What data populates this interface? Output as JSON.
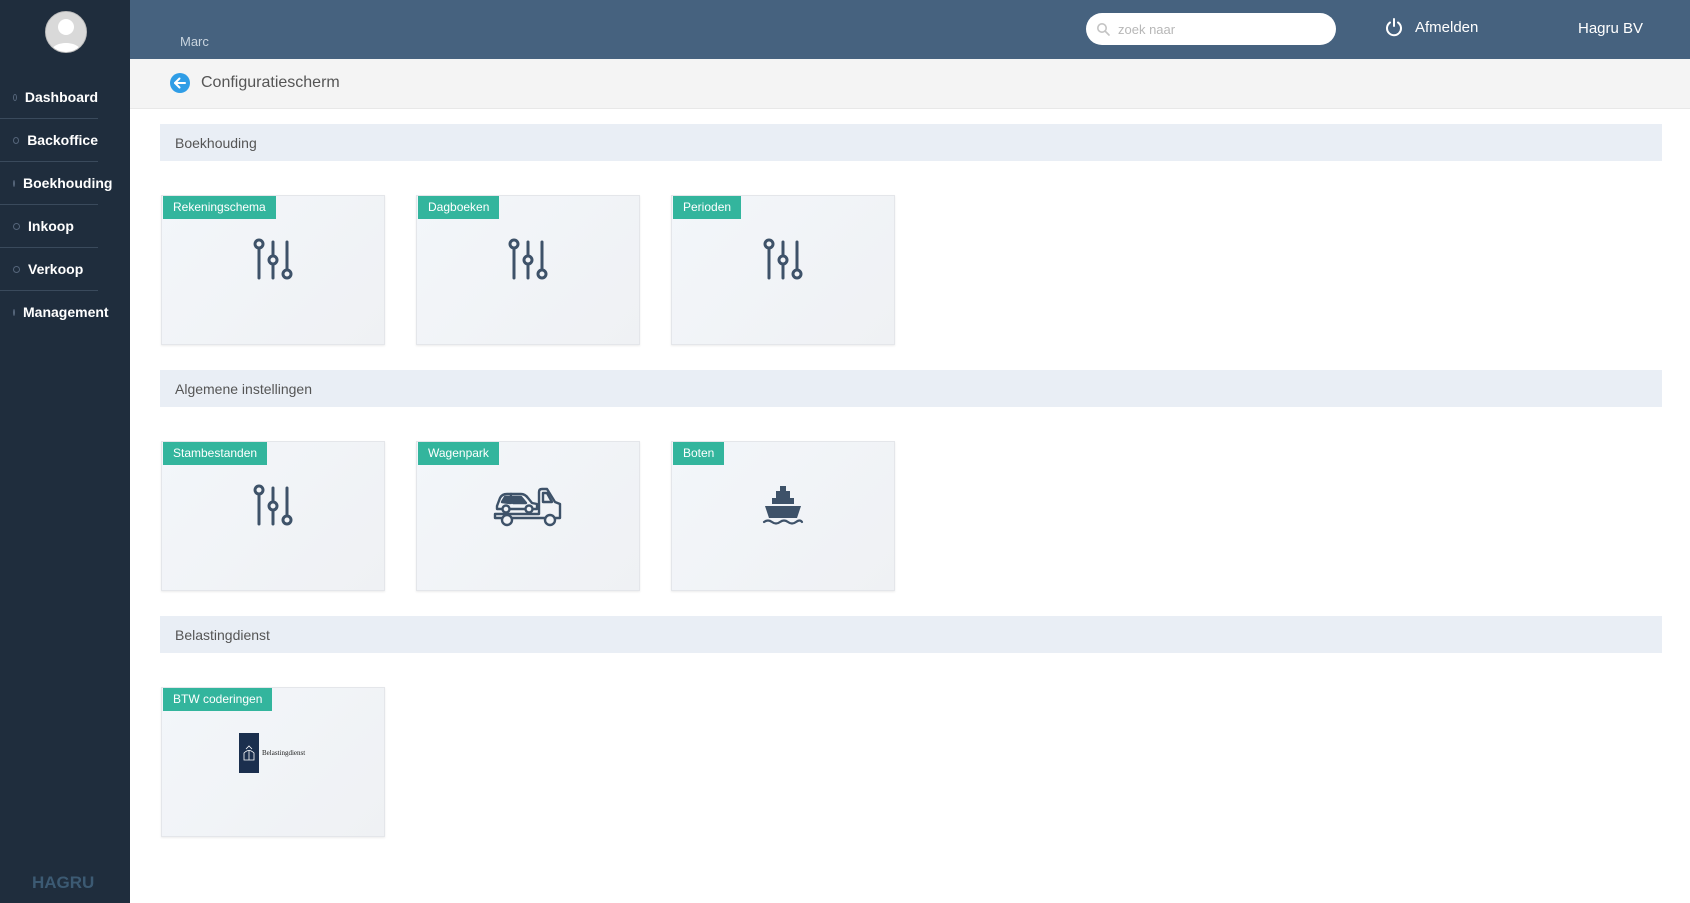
{
  "sidebar": {
    "items": [
      {
        "label": "Dashboard"
      },
      {
        "label": "Backoffice"
      },
      {
        "label": "Boekhouding"
      },
      {
        "label": "Inkoop"
      },
      {
        "label": "Verkoop"
      },
      {
        "label": "Management"
      }
    ],
    "brand": "HAGRU"
  },
  "topbar": {
    "username": "Marc",
    "search": {
      "placeholder": "zoek naar",
      "value": ""
    },
    "logout_label": "Afmelden",
    "company": "Hagru BV"
  },
  "page": {
    "title": "Configuratiescherm"
  },
  "sections": [
    {
      "title": "Boekhouding",
      "cards": [
        {
          "label": "Rekeningschema",
          "icon": "sliders-icon"
        },
        {
          "label": "Dagboeken",
          "icon": "sliders-icon"
        },
        {
          "label": "Perioden",
          "icon": "sliders-icon"
        }
      ]
    },
    {
      "title": "Algemene instellingen",
      "cards": [
        {
          "label": "Stambestanden",
          "icon": "sliders-icon"
        },
        {
          "label": "Wagenpark",
          "icon": "tow-truck-icon"
        },
        {
          "label": "Boten",
          "icon": "ship-icon"
        }
      ]
    },
    {
      "title": "Belastingdienst",
      "cards": [
        {
          "label": "BTW coderingen",
          "icon": "belastingdienst-logo",
          "logo_text": "Belastingdienst"
        }
      ]
    }
  ],
  "colors": {
    "sidebar": "#1f2d3d",
    "topbar": "#46627f",
    "tag": "#33b59d",
    "accent": "#2f9de6",
    "icon": "#3e5269"
  }
}
